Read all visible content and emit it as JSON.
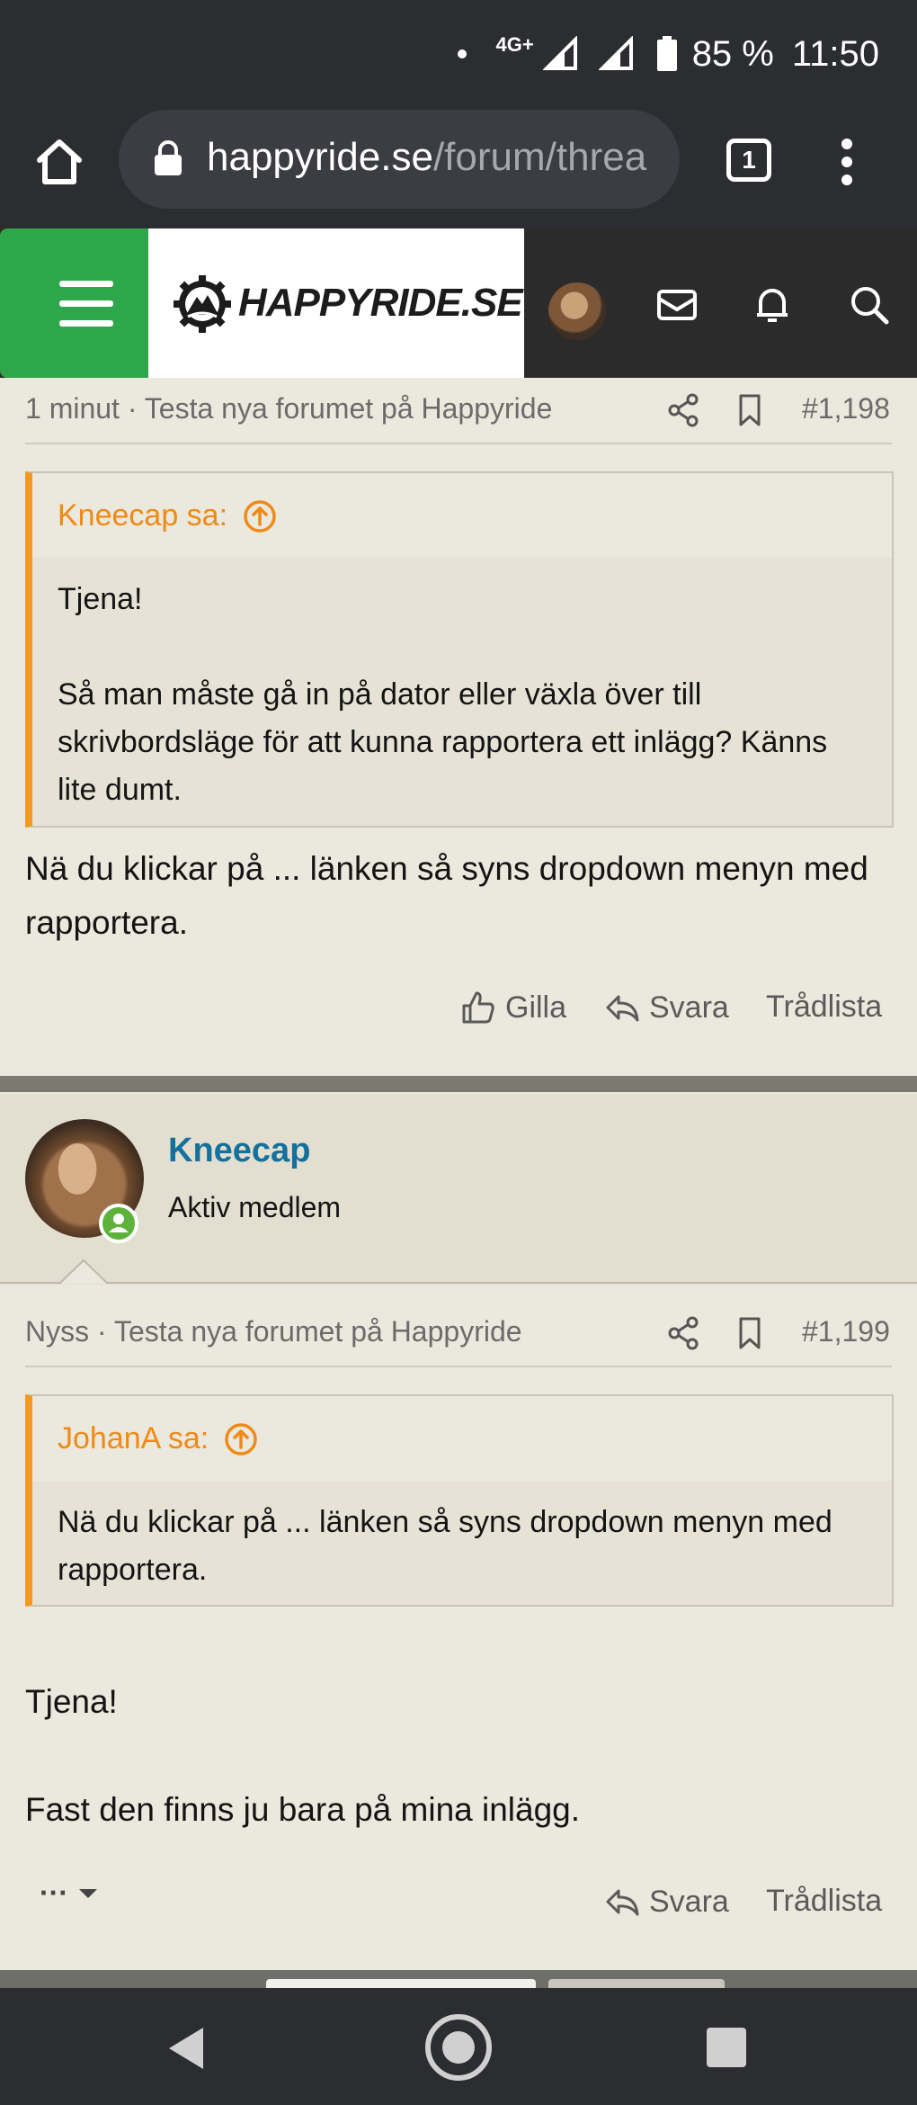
{
  "status_bar": {
    "network": "4G+",
    "battery": "85 %",
    "time": "11:50"
  },
  "browser": {
    "url_domain": "happyride.se",
    "url_path": "/forum/threa",
    "tab_count": "1"
  },
  "site": {
    "logo_text": "HAPPYRIDE.SE",
    "brand_green": "#2ea64a"
  },
  "posts": [
    {
      "meta_time": "1 minut",
      "meta_thread": "Testa nya forumet på Happyride",
      "number": "#1,198",
      "quote_author": "Kneecap sa:",
      "quote_paragraphs": [
        "Tjena!",
        "Så man måste gå in på dator eller växla över till skrivbordsläge för att kunna rapportera ett inlägg? Känns lite dumt."
      ],
      "body": "Nä du klickar på ... länken så syns dropdown menyn med rapportera.",
      "actions": {
        "like": "Gilla",
        "reply": "Svara",
        "thread_list": "Trådlista"
      }
    },
    {
      "author": "Kneecap",
      "author_title": "Aktiv medlem",
      "meta_time": "Nyss",
      "meta_thread": "Testa nya forumet på Happyride",
      "number": "#1,199",
      "quote_author": "JohanA sa:",
      "quote_paragraphs": [
        "Nä du klickar på ... länken så syns dropdown menyn med rapportera."
      ],
      "body_paragraphs": [
        "Tjena!",
        "Fast den finns ju bara på mina inlägg."
      ],
      "actions": {
        "more": "···",
        "reply": "Svara",
        "thread_list": "Trådlista"
      }
    }
  ]
}
